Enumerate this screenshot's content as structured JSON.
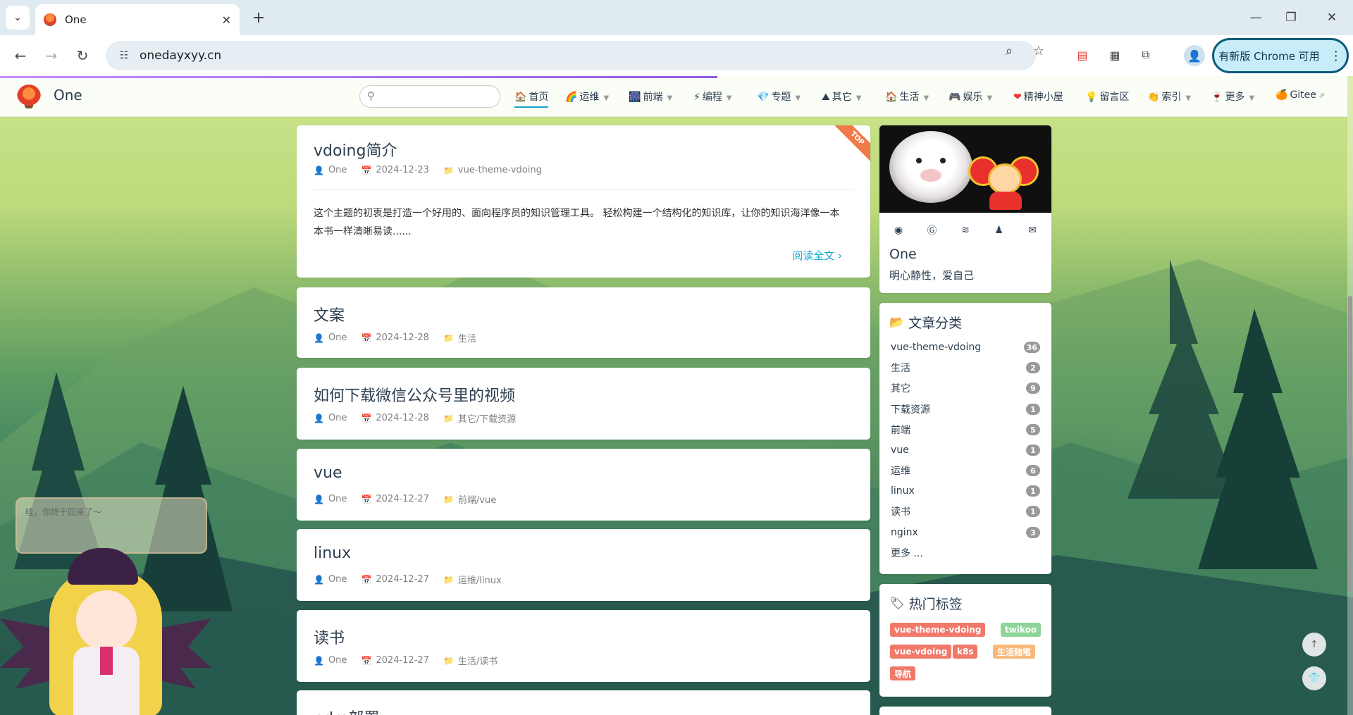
{
  "browser": {
    "tab": {
      "title": "One",
      "close": "✕"
    },
    "new_tab": "+",
    "window": {
      "minimize": "—",
      "restore": "❐",
      "close": "✕"
    },
    "address": {
      "url": "onedayxyy.cn"
    },
    "update_button": {
      "label": "有新版 Chrome 可用",
      "menu": "⋮"
    }
  },
  "site": {
    "name": "One",
    "search": {
      "placeholder": ""
    },
    "nav": [
      {
        "emoji": "🏠",
        "label": "首页",
        "active": true,
        "dropdown": false
      },
      {
        "emoji": "🌈",
        "label": "运维",
        "dropdown": true
      },
      {
        "emoji": "🎆",
        "label": "前端",
        "dropdown": true
      },
      {
        "emoji": "⚡",
        "label": "编程",
        "dropdown": true
      },
      {
        "emoji": "💎",
        "label": "专题",
        "dropdown": true
      },
      {
        "emoji": "⛰",
        "label": "其它",
        "dropdown": true
      },
      {
        "emoji": "🏠",
        "label": "生活",
        "dropdown": true
      },
      {
        "emoji": "🎮",
        "label": "娱乐",
        "dropdown": true
      },
      {
        "emoji": "❤",
        "label": "精神小屋",
        "dropdown": false
      },
      {
        "emoji": "💡",
        "label": "留言区",
        "dropdown": false
      },
      {
        "emoji": "👏",
        "label": "索引",
        "dropdown": true
      },
      {
        "emoji": "🍷",
        "label": "更多",
        "dropdown": true
      },
      {
        "emoji": "🍊",
        "label": "Gitee",
        "dropdown": false,
        "external": true
      }
    ]
  },
  "posts": [
    {
      "title": "vdoing简介",
      "author": "One",
      "date": "2024-12-23",
      "category": "vue-theme-vdoing",
      "top_badge": "TOP",
      "excerpt": "这个主题的初衷是打造一个好用的、面向程序员的知识管理工具。 轻松构建一个结构化的知识库，让你的知识海洋像一本本书一样清晰易读......",
      "read_more": "阅读全文"
    },
    {
      "title": "文案",
      "author": "One",
      "date": "2024-12-28",
      "category": "生活"
    },
    {
      "title": "如何下载微信公众号里的视频",
      "author": "One",
      "date": "2024-12-28",
      "category": "其它/下载资源"
    },
    {
      "title": "vue",
      "author": "One",
      "date": "2024-12-27",
      "category": "前端/vue"
    },
    {
      "title": "linux",
      "author": "One",
      "date": "2024-12-27",
      "category": "运维/linux"
    },
    {
      "title": "读书",
      "author": "One",
      "date": "2024-12-27",
      "category": "生活/读书"
    },
    {
      "title": "pdm部署",
      "author": "",
      "date": "",
      "category": ""
    }
  ],
  "blogger": {
    "name": "One",
    "slogan": "明心静性，爱自己",
    "social_icons": [
      "github-icon",
      "gitee-icon",
      "rss-icon",
      "qq-icon",
      "email-icon"
    ]
  },
  "categories": {
    "title": "文章分类",
    "items": [
      {
        "name": "vue-theme-vdoing",
        "count": "36"
      },
      {
        "name": "生活",
        "count": "2"
      },
      {
        "name": "其它",
        "count": "9"
      },
      {
        "name": "下载资源",
        "count": "1"
      },
      {
        "name": "前端",
        "count": "5"
      },
      {
        "name": "vue",
        "count": "1"
      },
      {
        "name": "运维",
        "count": "6"
      },
      {
        "name": "linux",
        "count": "1"
      },
      {
        "name": "读书",
        "count": "1"
      },
      {
        "name": "nginx",
        "count": "3"
      }
    ],
    "more": "更多 ..."
  },
  "tags": {
    "title": "热门标签",
    "items": [
      {
        "name": "vue-theme-vdoing",
        "color": "#f0796a"
      },
      {
        "name": "twikoo",
        "color": "#8fd59a"
      },
      {
        "name": "vue-vdoing",
        "color": "#f0796a"
      },
      {
        "name": "k8s",
        "color": "#f0796a"
      },
      {
        "name": "生活随笔",
        "color": "#f7b97a"
      },
      {
        "name": "导航",
        "color": "#f0796a"
      }
    ]
  },
  "live2d": {
    "tip": "哇，你终于回来了～"
  },
  "float_buttons": {
    "top": "↑",
    "theme": "👕"
  },
  "colors": {
    "accent": "#11a8cd",
    "progress": "#a872f0"
  }
}
